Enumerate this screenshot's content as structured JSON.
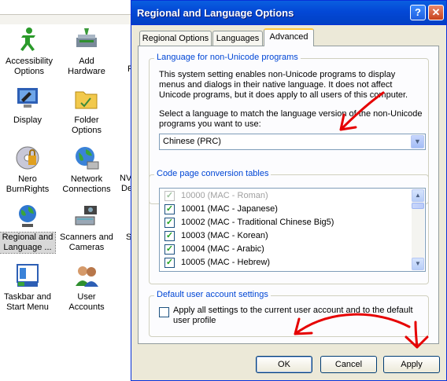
{
  "control_panel": {
    "items": [
      {
        "label": "Accessibility Options"
      },
      {
        "label": "Add Hardware"
      },
      {
        "label": "Display"
      },
      {
        "label": "Folder Options"
      },
      {
        "label": "Nero BurnRights"
      },
      {
        "label": "Network Connections"
      },
      {
        "label": "Regional and Language ..."
      },
      {
        "label": "Scanners and Cameras"
      },
      {
        "label": "Taskbar and Start Menu"
      },
      {
        "label": "User Accounts"
      }
    ],
    "partial_labels": [
      "P",
      "NV",
      "De",
      "S"
    ]
  },
  "dialog": {
    "title": "Regional and Language Options",
    "help_glyph": "?",
    "close_glyph": "✕",
    "tabs": [
      {
        "label": "Regional Options",
        "active": false
      },
      {
        "label": "Languages",
        "active": false
      },
      {
        "label": "Advanced",
        "active": true
      }
    ],
    "non_unicode": {
      "group_title": "Language for non-Unicode programs",
      "description": "This system setting enables non-Unicode programs to display menus and dialogs in their native language. It does not affect Unicode programs, but it does apply to all users of this computer.",
      "select_prompt": "Select a language to match the language version of the non-Unicode programs you want to use:",
      "selected_language": "Chinese (PRC)"
    },
    "code_pages": {
      "group_title": "Code page conversion tables",
      "rows": [
        {
          "label": "10000 (MAC - Roman)",
          "checked": true,
          "disabled": true
        },
        {
          "label": "10001 (MAC - Japanese)",
          "checked": true,
          "disabled": false
        },
        {
          "label": "10002 (MAC - Traditional Chinese Big5)",
          "checked": true,
          "disabled": false
        },
        {
          "label": "10003 (MAC - Korean)",
          "checked": true,
          "disabled": false
        },
        {
          "label": "10004 (MAC - Arabic)",
          "checked": true,
          "disabled": false
        },
        {
          "label": "10005 (MAC - Hebrew)",
          "checked": true,
          "disabled": false
        }
      ]
    },
    "default_user": {
      "group_title": "Default user account settings",
      "checkbox_label": "Apply all settings to the current user account and to the default user profile",
      "checked": false
    },
    "buttons": {
      "ok": "OK",
      "cancel": "Cancel",
      "apply": "Apply"
    }
  },
  "colors": {
    "annotation": "#e60000",
    "titlebar": "#0348d6",
    "group_title": "#0046d5"
  }
}
